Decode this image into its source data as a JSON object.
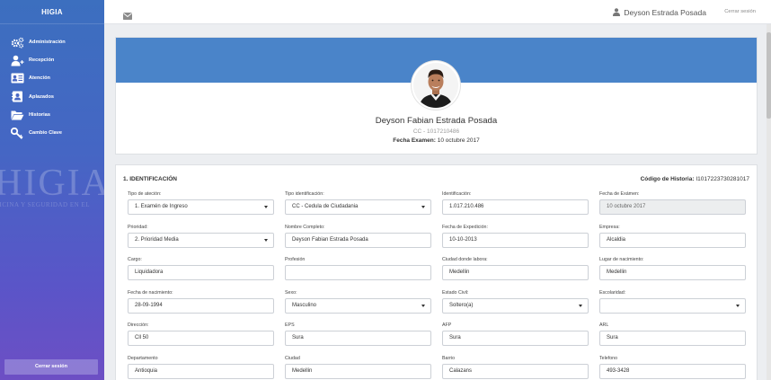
{
  "sidebar": {
    "brand": "HIGIA",
    "items": [
      {
        "label": "Administración",
        "icon": "gears-icon"
      },
      {
        "label": "Recepción",
        "icon": "user-plus-icon"
      },
      {
        "label": "Atención",
        "icon": "id-card-icon"
      },
      {
        "label": "Aplazados",
        "icon": "address-book-icon"
      },
      {
        "label": "Historias",
        "icon": "folder-open-icon"
      },
      {
        "label": "Cambio Clave",
        "icon": "key-icon"
      }
    ],
    "watermark": "HIGIA",
    "watermark_tagline": "DICINA Y SEGURIDAD EN EL",
    "logout_label": "Cerrar sesión"
  },
  "topbar": {
    "mail_icon": "envelope-icon",
    "user_icon": "user-icon",
    "user_name": "Deyson Estrada Posada",
    "signout_label": "Cerrar sesión"
  },
  "profile": {
    "name": "Deyson Fabian Estrada Posada",
    "document": "CC - 1017210486",
    "exam_date_label": "Fecha Examen:",
    "exam_date": "10 octubre 2017"
  },
  "form": {
    "section_title": "1. IDENTIFICACIÓN",
    "history_label": "Código de Historia:",
    "history_code": "I1017223730281017",
    "fields": [
      {
        "label": "Tipo de ateción:",
        "value": "1. Examén de Ingreso",
        "kind": "select"
      },
      {
        "label": "Tipo identificación:",
        "value": "CC - Cedula de Ciudadania",
        "kind": "select"
      },
      {
        "label": "Identificación:",
        "value": "1.017.210.486",
        "kind": "input"
      },
      {
        "label": "Fecha de Exámen:",
        "value": "10 octubre 2017",
        "kind": "disabled"
      },
      {
        "label": "Prioridad:",
        "value": "2. Prioridad Media",
        "kind": "select"
      },
      {
        "label": "Nombre Completo:",
        "value": "Deyson Fabian Estrada Posada",
        "kind": "input"
      },
      {
        "label": "Fecha de Expedición:",
        "value": "10-10-2013",
        "kind": "input"
      },
      {
        "label": "Empresa:",
        "value": "Alcaldia",
        "kind": "input"
      },
      {
        "label": "Cargo:",
        "value": "Liquidadora",
        "kind": "input"
      },
      {
        "label": "Profesión",
        "value": "",
        "kind": "input"
      },
      {
        "label": "Ciudad donde labora:",
        "value": "Medellin",
        "kind": "input"
      },
      {
        "label": "Lugar de nacimiento:",
        "value": "Medellin",
        "kind": "input"
      },
      {
        "label": "Fecha de nacimiento:",
        "value": "28-09-1994",
        "kind": "input"
      },
      {
        "label": "Sexo:",
        "value": "Masculino",
        "kind": "select"
      },
      {
        "label": "Estado Civil:",
        "value": "Soltero(a)",
        "kind": "select"
      },
      {
        "label": "Escolaridad:",
        "value": "",
        "kind": "select"
      },
      {
        "label": "Dirección:",
        "value": "Cll 50",
        "kind": "input"
      },
      {
        "label": "EPS",
        "value": "Sura",
        "kind": "input"
      },
      {
        "label": "AFP",
        "value": "Sura",
        "kind": "input"
      },
      {
        "label": "ARL",
        "value": "Sura",
        "kind": "input"
      },
      {
        "label": "Departamento",
        "value": "Antioquia",
        "kind": "input"
      },
      {
        "label": "Ciudad",
        "value": "Medellin",
        "kind": "input"
      },
      {
        "label": "Barrio",
        "value": "Calazans",
        "kind": "input"
      },
      {
        "label": "Telefono",
        "value": "493-3428",
        "kind": "input"
      }
    ]
  }
}
